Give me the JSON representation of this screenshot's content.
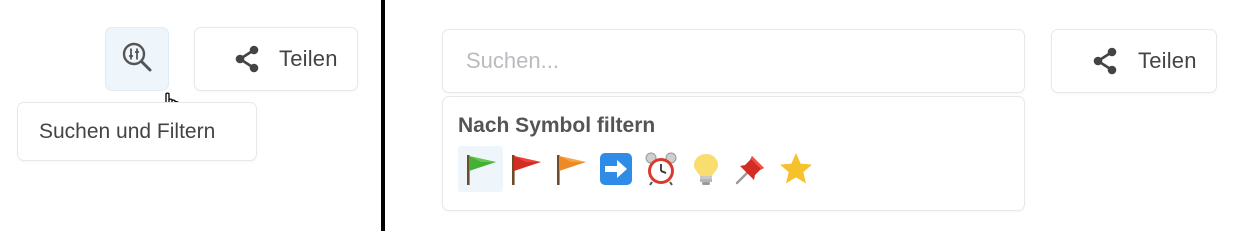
{
  "left": {
    "share_label": "Teilen",
    "tooltip_text": "Suchen und Filtern"
  },
  "right": {
    "search_placeholder": "Suchen...",
    "share_label": "Teilen",
    "filter_title": "Nach Symbol filtern",
    "symbols": [
      "green-flag",
      "red-flag",
      "orange-flag",
      "right-arrow",
      "alarm-clock",
      "light-bulb",
      "pushpin",
      "star"
    ],
    "active_symbol": "green-flag"
  },
  "colors": {
    "accent_bg": "#eef5fb",
    "text": "#444444",
    "placeholder": "#b8bcc0",
    "divider": "#000000"
  }
}
